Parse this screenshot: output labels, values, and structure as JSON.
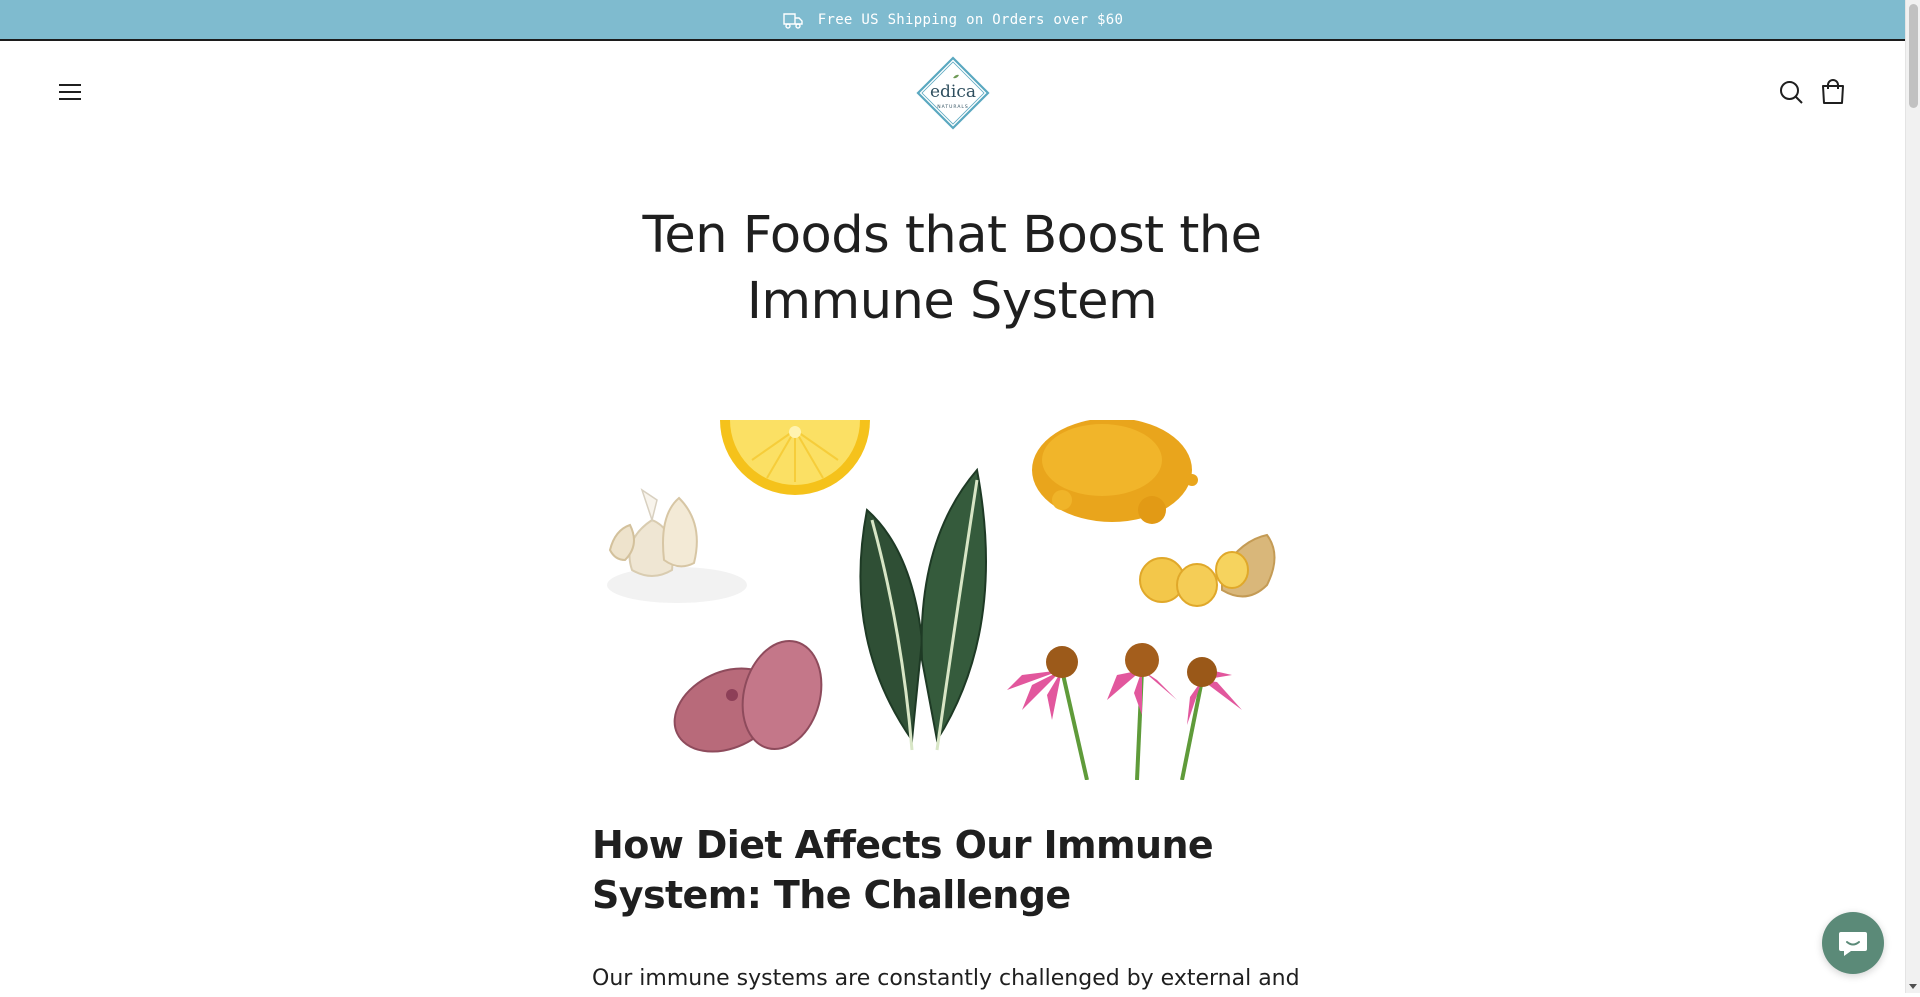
{
  "announcement": {
    "text": "Free US Shipping on Orders over $60",
    "icon": "truck-icon"
  },
  "header": {
    "menu_icon": "hamburger-menu-icon",
    "logo": {
      "name": "edica",
      "subname": "NATURALS"
    },
    "search_icon": "search-icon",
    "cart_icon": "shopping-bag-icon"
  },
  "article": {
    "title": "Ten Foods that Boost the Immune System",
    "hero_image": "immune-foods-collage",
    "section_heading": "How Diet Affects Our Immune System: The Challenge",
    "paragraph": "Our immune systems are constantly challenged by external and"
  },
  "chat": {
    "icon": "chat-bubble-icon"
  },
  "colors": {
    "announcement_bg": "#7fbbcf",
    "logo_teal": "#5aa8c0",
    "text": "#1f1f1f",
    "chat_bg": "#5b8a78"
  }
}
